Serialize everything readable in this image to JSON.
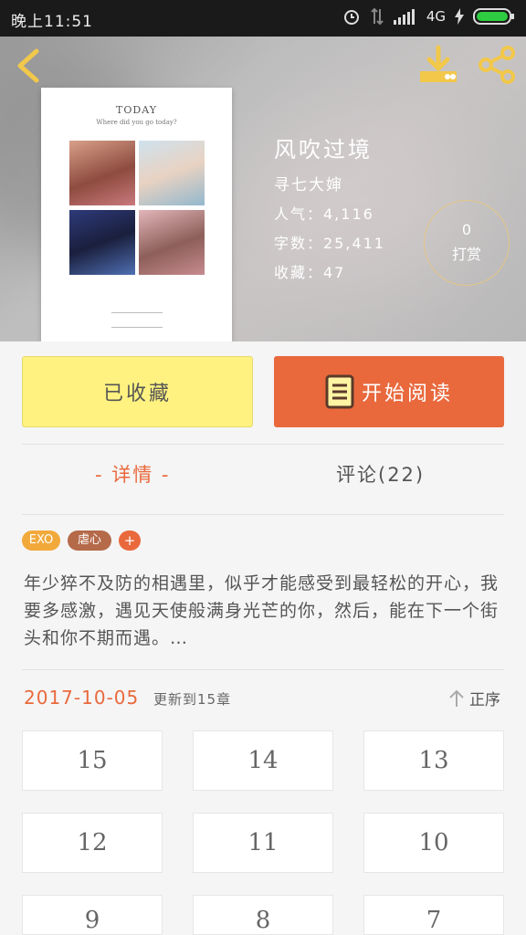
{
  "status_bar": {
    "time": "晚上11:51",
    "network": "4G"
  },
  "book": {
    "cover": {
      "title": "TODAY",
      "subtitle": "Where did you go today?"
    },
    "title": "风吹过境",
    "author": "寻七大婶",
    "popularity": "人气：4,116",
    "word_count": "字数：25,411",
    "favorites": "收藏：47",
    "reward_count": "0",
    "reward_label": "打赏"
  },
  "actions": {
    "favorited_label": "已收藏",
    "read_label": "开始阅读"
  },
  "tabs": {
    "details": "- 详情 -",
    "comments": "评论(22)"
  },
  "tags": [
    "EXO",
    "虐心",
    "+"
  ],
  "description": "年少猝不及防的相遇里，似乎才能感受到最轻松的开心，我要多感激，遇见天使般满身光芒的你，然后，能在下一个街头和你不期而遇。…",
  "update": {
    "date": "2017-10-05",
    "text": "更新到15章",
    "sort_label": "正序"
  },
  "chapters": [
    "15",
    "14",
    "13",
    "12",
    "11",
    "10",
    "9",
    "8",
    "7"
  ],
  "colors": {
    "accent": "#e9693d",
    "favorite_bg": "#fff280",
    "tag_exo": "#f2a93b",
    "tag_sad": "#b56a4a",
    "tag_plus": "#e9693d"
  }
}
